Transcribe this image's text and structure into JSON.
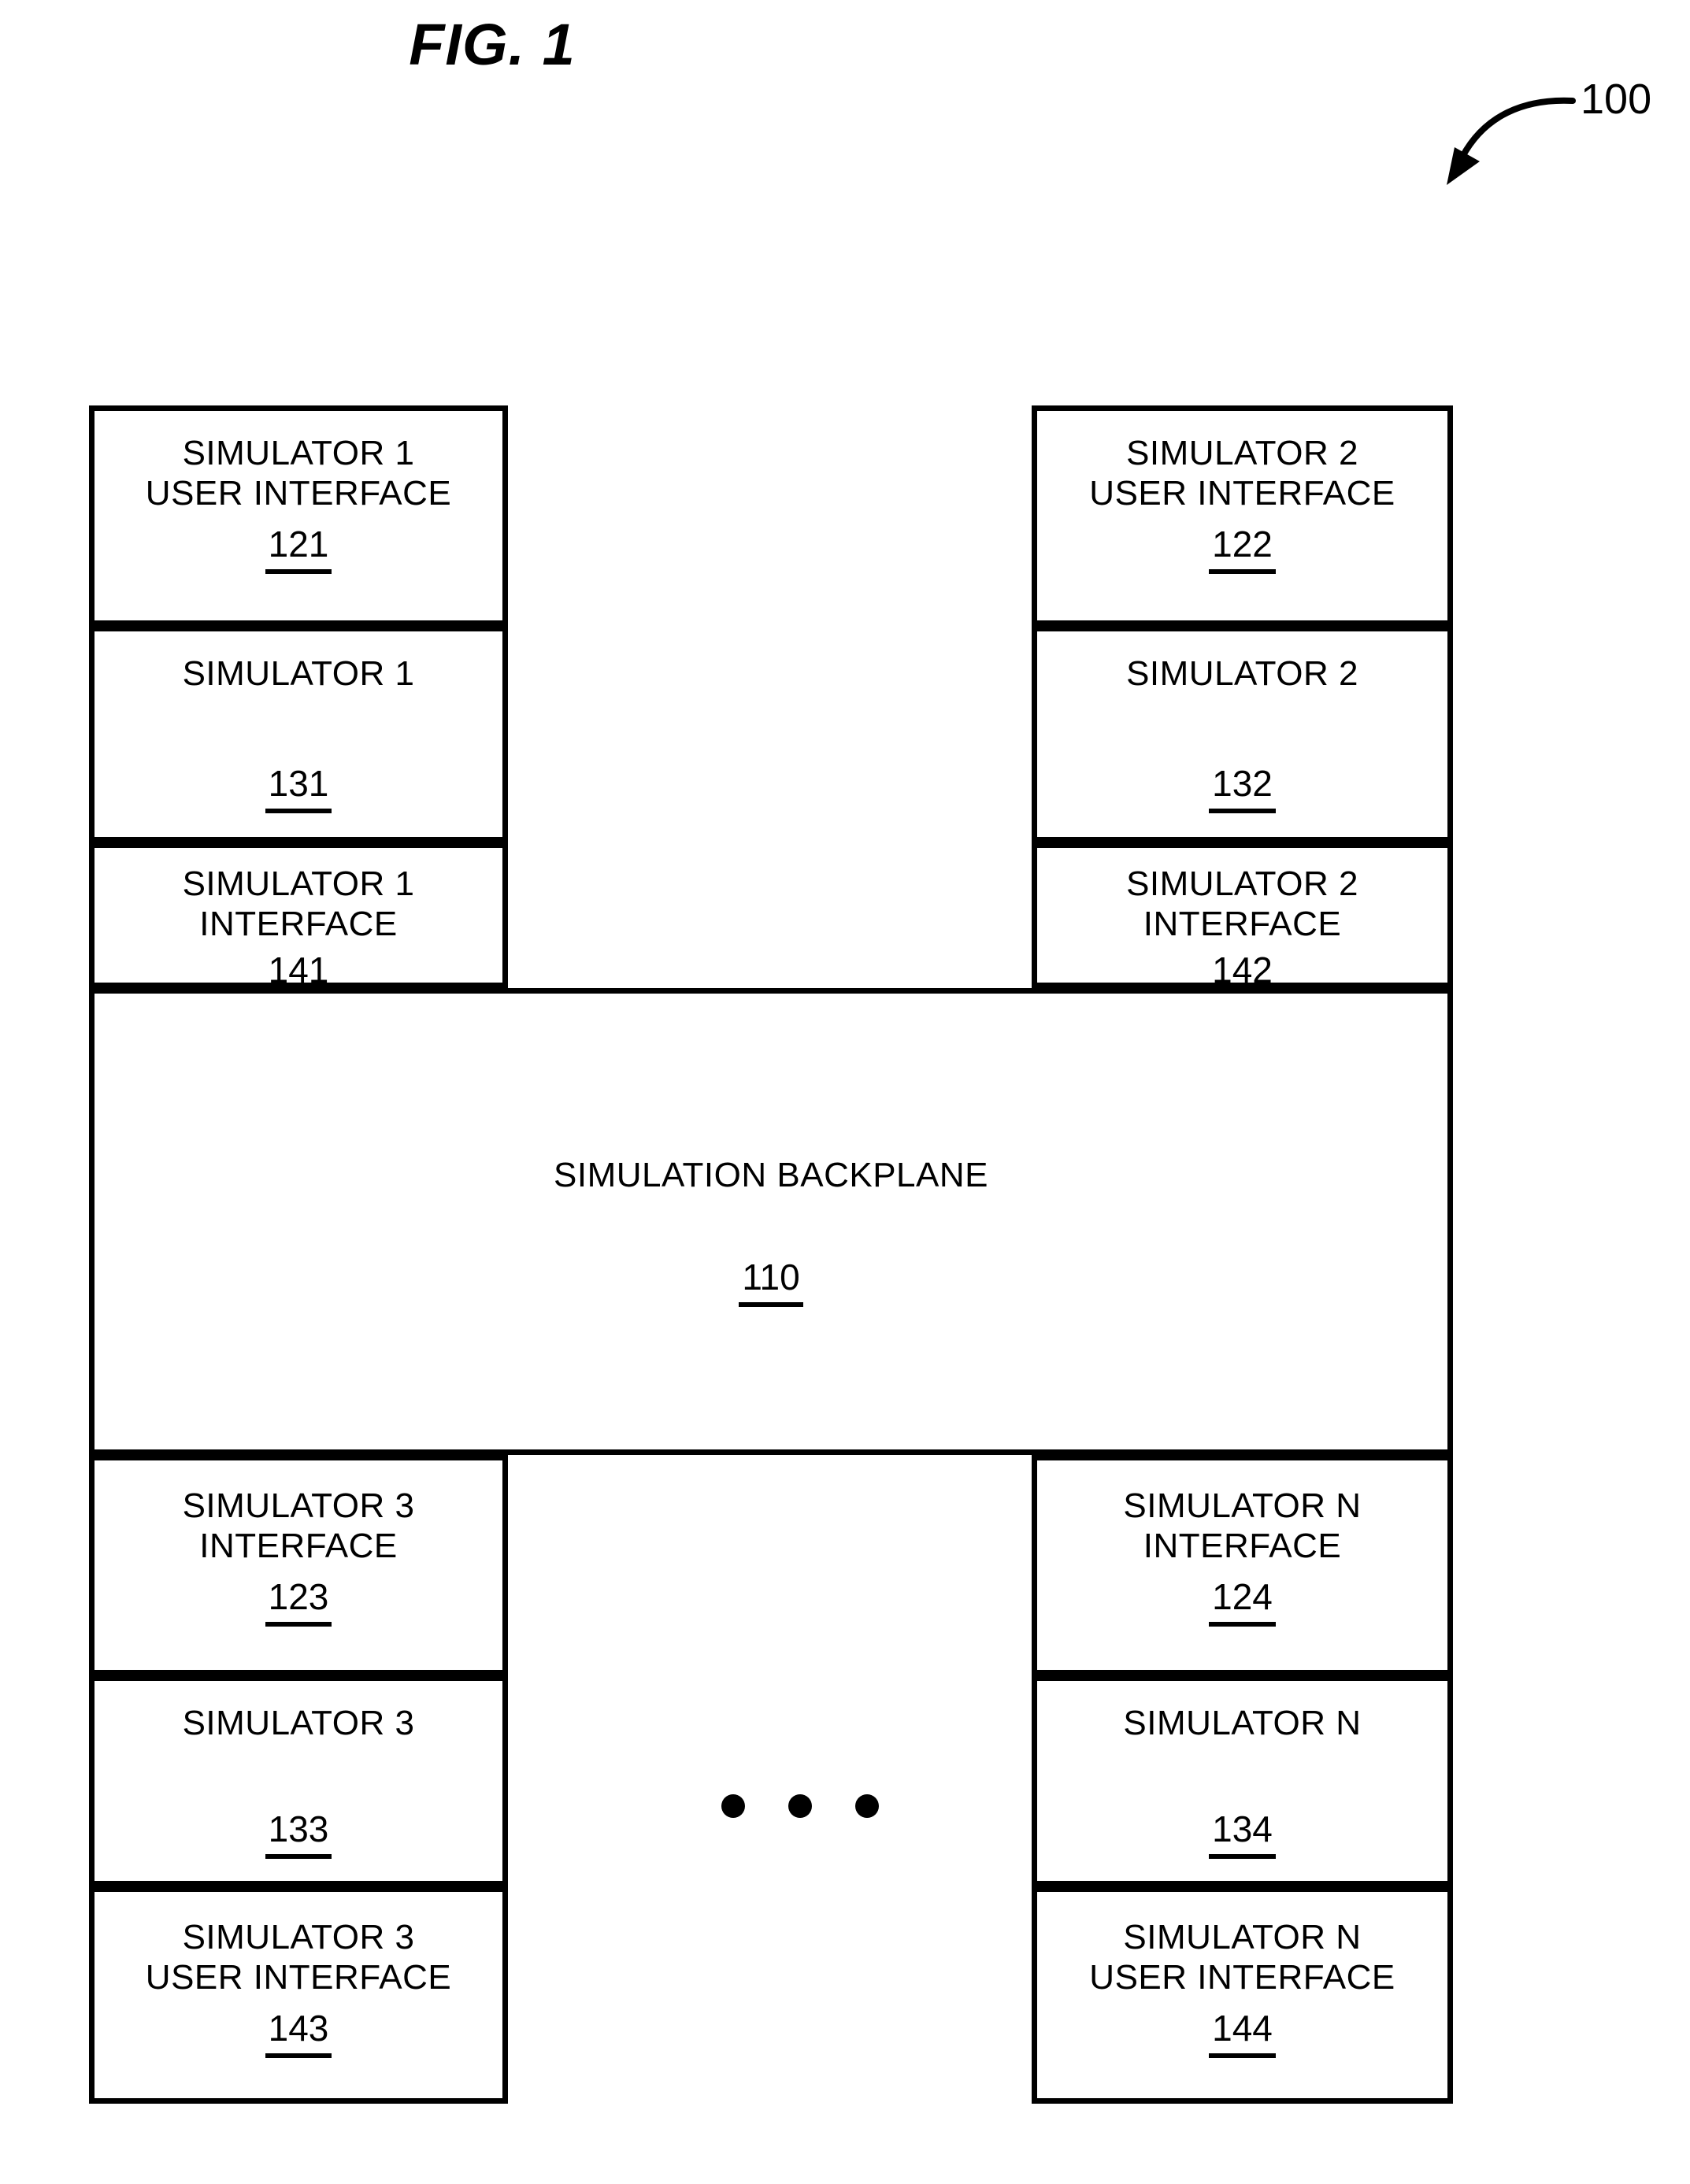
{
  "figure": {
    "title": "FIG. 1",
    "reference_numeral": "100"
  },
  "diagram": {
    "type": "block-diagram",
    "backplane": {
      "label": "SIMULATION BACKPLANE",
      "numeral": "110"
    },
    "ellipsis": "• • •",
    "top_left": [
      {
        "lines": [
          "SIMULATOR 1",
          "USER INTERFACE"
        ],
        "numeral": "121"
      },
      {
        "lines": [
          "SIMULATOR 1"
        ],
        "numeral": "131"
      },
      {
        "lines": [
          "SIMULATOR 1",
          "INTERFACE"
        ],
        "numeral": "141"
      }
    ],
    "top_right": [
      {
        "lines": [
          "SIMULATOR 2",
          "USER INTERFACE"
        ],
        "numeral": "122"
      },
      {
        "lines": [
          "SIMULATOR 2"
        ],
        "numeral": "132"
      },
      {
        "lines": [
          "SIMULATOR 2",
          "INTERFACE"
        ],
        "numeral": "142"
      }
    ],
    "bottom_left": [
      {
        "lines": [
          "SIMULATOR 3",
          "INTERFACE"
        ],
        "numeral": "123"
      },
      {
        "lines": [
          "SIMULATOR 3"
        ],
        "numeral": "133"
      },
      {
        "lines": [
          "SIMULATOR 3",
          "USER INTERFACE"
        ],
        "numeral": "143"
      }
    ],
    "bottom_right": [
      {
        "lines": [
          "SIMULATOR N",
          "INTERFACE"
        ],
        "numeral": "124"
      },
      {
        "lines": [
          "SIMULATOR N"
        ],
        "numeral": "134"
      },
      {
        "lines": [
          "SIMULATOR N",
          "USER INTERFACE"
        ],
        "numeral": "144"
      }
    ]
  },
  "boxes": {
    "b121": {
      "l1": "SIMULATOR 1",
      "l2": "USER INTERFACE",
      "num": "121"
    },
    "b131": {
      "l1": "SIMULATOR 1",
      "num": "131"
    },
    "b141": {
      "l1": "SIMULATOR 1",
      "l2": "INTERFACE",
      "num": "141"
    },
    "b122": {
      "l1": "SIMULATOR 2",
      "l2": "USER INTERFACE",
      "num": "122"
    },
    "b132": {
      "l1": "SIMULATOR 2",
      "num": "132"
    },
    "b142": {
      "l1": "SIMULATOR 2",
      "l2": "INTERFACE",
      "num": "142"
    },
    "b110": {
      "l1": "SIMULATION BACKPLANE",
      "num": "110"
    },
    "b123": {
      "l1": "SIMULATOR 3",
      "l2": "INTERFACE",
      "num": "123"
    },
    "b133": {
      "l1": "SIMULATOR 3",
      "num": "133"
    },
    "b143": {
      "l1": "SIMULATOR 3",
      "l2": "USER INTERFACE",
      "num": "143"
    },
    "b124": {
      "l1": "SIMULATOR N",
      "l2": "INTERFACE",
      "num": "124"
    },
    "b134": {
      "l1": "SIMULATOR N",
      "num": "134"
    },
    "b144": {
      "l1": "SIMULATOR N",
      "l2": "USER INTERFACE",
      "num": "144"
    }
  },
  "colors": {
    "ink": "#000000",
    "paper": "#ffffff"
  }
}
